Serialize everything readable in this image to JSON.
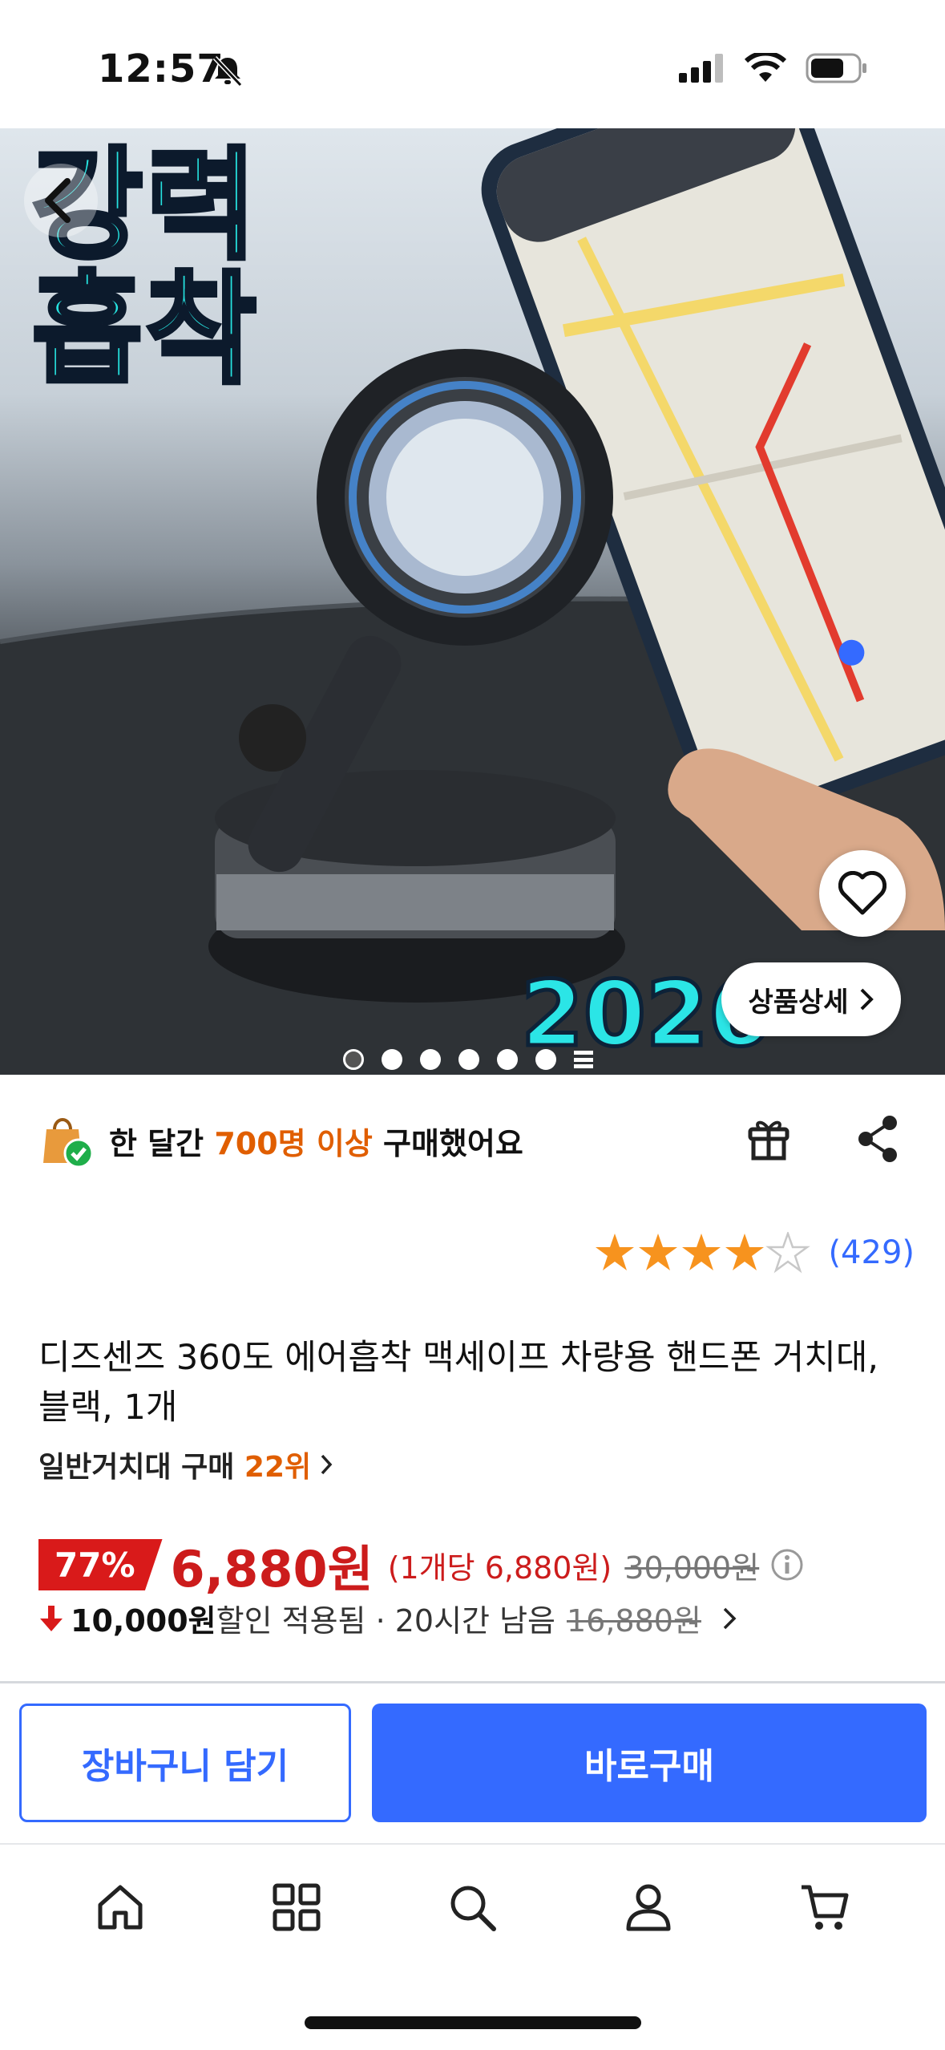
{
  "status_bar": {
    "time": "12:57"
  },
  "hero": {
    "headline_line1": "강력",
    "headline_line2": "흡착",
    "year_text": "2026",
    "detail_button_label": "상품상세",
    "dots_total": 6,
    "dots_active_index": 0
  },
  "purchase_info": {
    "prefix": "한 달간 ",
    "highlight": "700명 이상",
    "suffix": " 구매했어요"
  },
  "rating": {
    "stars": 4,
    "max": 5,
    "count": "(429)"
  },
  "product": {
    "title": "디즈센즈 360도 에어흡착 맥세이프 차량용 핸드폰 거치대, 블랙, 1개",
    "rank_prefix": "일반거치대 구매 ",
    "rank_value": "22위"
  },
  "price": {
    "discount": "77%",
    "sale_price": "6,880원",
    "unit_price": "(1개당 6,880원)",
    "original_price": "30,000원"
  },
  "coupon": {
    "amount": "10,000원",
    "text": " 할인 적용됨 · 20시간 남음",
    "before_price": "16,880원"
  },
  "actions": {
    "cart_label": "장바구니 담기",
    "buy_label": "바로구매"
  },
  "nav": [
    "home-icon",
    "category-grid-icon",
    "search-icon",
    "my-page-icon",
    "cart-icon"
  ],
  "colors": {
    "accent": "#346aff",
    "sale_red": "#cc1c1c",
    "highlight_orange": "#e05e00"
  }
}
